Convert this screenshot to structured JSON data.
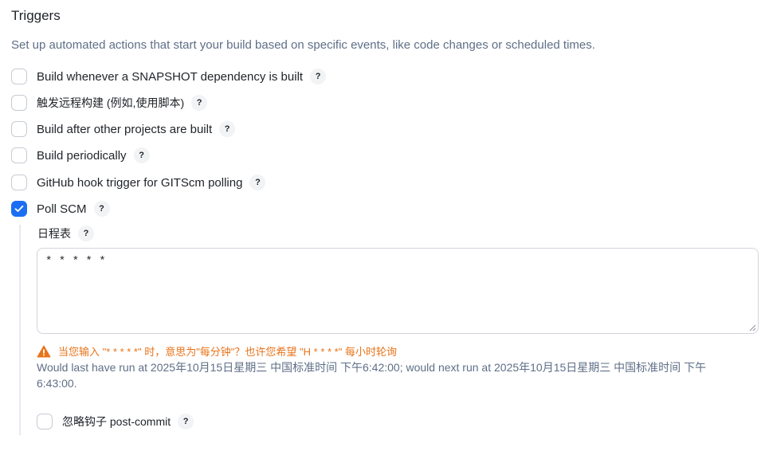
{
  "section": {
    "title": "Triggers",
    "description": "Set up automated actions that start your build based on specific events, like code changes or scheduled times."
  },
  "help_glyph": "?",
  "triggers": [
    {
      "label": "Build whenever a SNAPSHOT dependency is built",
      "checked": false
    },
    {
      "label": "触发远程构建 (例如,使用脚本)",
      "checked": false
    },
    {
      "label": "Build after other projects are built",
      "checked": false
    },
    {
      "label": "Build periodically",
      "checked": false
    },
    {
      "label": "GitHub hook trigger for GITScm polling",
      "checked": false
    },
    {
      "label": "Poll SCM",
      "checked": true
    }
  ],
  "poll_scm": {
    "schedule_label": "日程表",
    "schedule_value": "* * * * *",
    "warning": "当您输入 \"* * * * *\" 时，意思为\"每分钟\"？也许您希望 \"H * * * *\" 每小时轮询",
    "run_info": "Would last have run at 2025年10月15日星期三 中国标准时间 下午6:42:00; would next run at 2025年10月15日星期三 中国标准时间 下午6:43:00.",
    "ignore_post_commit": {
      "label": "忽略钩子 post-commit",
      "checked": false
    }
  },
  "colors": {
    "accent": "#1b6ef3",
    "warning": "#e8741a",
    "muted_text": "#5f6f87"
  },
  "icons": {
    "checkmark": "check-icon",
    "warning": "warning-triangle-icon",
    "help": "help-icon"
  }
}
